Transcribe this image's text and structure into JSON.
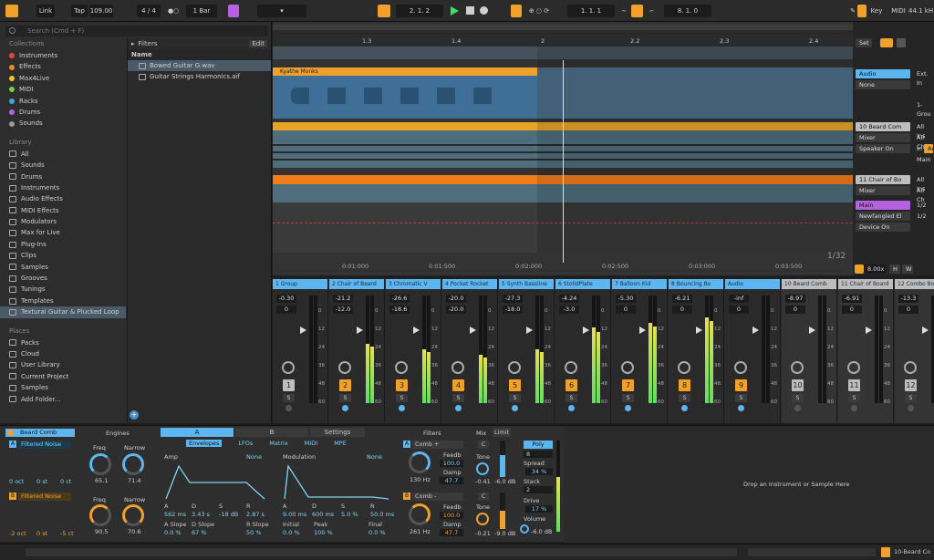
{
  "transport": {
    "link": "Link",
    "tap": "Tap",
    "tempo": "109.00",
    "time_sig": "4 / 4",
    "quant": "1 Bar",
    "arr_pos": "2.   1.   2",
    "loop_start": "1.   1.   1",
    "loop_len": "8.   1.   0",
    "key": "Key",
    "midi": "MIDI",
    "sample_rate": "44.1 kH"
  },
  "browser": {
    "search_placeholder": "Search (Cmd + F)",
    "collections_header": "Collections",
    "collections": [
      {
        "label": "Instruments",
        "color": "#e8433a"
      },
      {
        "label": "Effects",
        "color": "#f08a28"
      },
      {
        "label": "Max4Live",
        "color": "#f2c230"
      },
      {
        "label": "MIDI",
        "color": "#6fd14a"
      },
      {
        "label": "Racks",
        "color": "#3aa5e8"
      },
      {
        "label": "Drums",
        "color": "#b460e0"
      },
      {
        "label": "Sounds",
        "color": "#9a9a9a"
      }
    ],
    "library_header": "Library",
    "library": [
      "All",
      "Sounds",
      "Drums",
      "Instruments",
      "Audio Effects",
      "MIDI Effects",
      "Modulators",
      "Max for Live",
      "Plug-Ins",
      "Clips",
      "Samples",
      "Grooves",
      "Tunings",
      "Templates",
      "Textural Guitar & Plucked Loop"
    ],
    "places_header": "Places",
    "places": [
      "Packs",
      "Cloud",
      "User Library",
      "Current Project",
      "Samples",
      "Add Folder..."
    ],
    "filters_label": "Filters",
    "edit_label": "Edit",
    "name_col": "Name",
    "files": [
      "Bowed Guitar G.wav",
      "Guitar Strings Harmonics.aif"
    ]
  },
  "arrangement": {
    "ruler": [
      "1.3",
      "1.4",
      "2",
      "2.2",
      "2.3",
      "2.4"
    ],
    "clip1_name": "Kyathe Monks",
    "time_ruler": [
      "0:01:000",
      "0:01:500",
      "0:02:000",
      "0:02:500",
      "0:03:000",
      "0:03:500"
    ],
    "grid": "1/32",
    "set_label": "Set",
    "zoom": "8.00x",
    "h_label": "H",
    "w_label": "W"
  },
  "io_panel": {
    "audio": "Audio",
    "ext": "Ext. In",
    "none": "None",
    "group1": "1-Grou",
    "beard_comb": "10 Beard Com",
    "all_ins1": "All Ins",
    "mixer1": "Mixer",
    "all_ch1": "All Ch",
    "speaker_on": "Speaker On",
    "in": "In",
    "auto": "Au",
    "main1": "Main",
    "chair": "11 Chair of Bo",
    "all_ins2": "All Ins",
    "mixer2": "Mixer",
    "all_ch2": "All Ch",
    "main2": "Main",
    "half1": "1/2",
    "newfangled": "Newfangled El",
    "half2": "1/2",
    "device_on": "Device On"
  },
  "mixer": {
    "strips": [
      {
        "name": "1 Group",
        "color": "#5db6f0",
        "vol": "-0.30",
        "pan": "0",
        "num": "1",
        "numcolor": "#bdbdbd",
        "level": 0
      },
      {
        "name": "2 Chair of Beard",
        "color": "#5db6f0",
        "vol": "-21.2",
        "pan": "-12.0",
        "num": "2",
        "numcolor": "#f0a12b",
        "level": 0.55
      },
      {
        "name": "3 Chromatic V",
        "color": "#5db6f0",
        "vol": "-26.6",
        "pan": "-18.6",
        "num": "3",
        "numcolor": "#f0a12b",
        "level": 0.5
      },
      {
        "name": "4 Pocket Rocket",
        "color": "#5db6f0",
        "vol": "-20.0",
        "pan": "-20.0",
        "num": "4",
        "numcolor": "#f0a12b",
        "level": 0.45
      },
      {
        "name": "5 Synth Bassline",
        "color": "#5db6f0",
        "vol": "-27.3",
        "pan": "-18.0",
        "num": "5",
        "numcolor": "#f0a12b",
        "level": 0.5
      },
      {
        "name": "6 StolidPlate",
        "color": "#5db6f0",
        "vol": "-4.24",
        "pan": "-3.0",
        "num": "6",
        "numcolor": "#f0a12b",
        "level": 0.7
      },
      {
        "name": "7 Balloon Kid",
        "color": "#5db6f0",
        "vol": "-5.30",
        "pan": "0",
        "num": "7",
        "numcolor": "#f0a12b",
        "level": 0.75
      },
      {
        "name": "8 Bouncing Bo",
        "color": "#5db6f0",
        "vol": "-6.21",
        "pan": "0",
        "num": "8",
        "numcolor": "#f0a12b",
        "level": 0.8
      },
      {
        "name": "Audio",
        "color": "#5db6f0",
        "vol": "-inf",
        "pan": "0",
        "num": "9",
        "numcolor": "#f0a12b",
        "level": 0
      },
      {
        "name": "10 Beard Comb",
        "color": "#bdbdbd",
        "vol": "-8.97",
        "pan": "0",
        "num": "10",
        "numcolor": "#bdbdbd",
        "level": 0
      },
      {
        "name": "11 Chair of Board",
        "color": "#bdbdbd",
        "vol": "-6.91",
        "pan": "0",
        "num": "11",
        "numcolor": "#bdbdbd",
        "level": 0
      },
      {
        "name": "12 Combo Bo",
        "color": "#bdbdbd",
        "vol": "-13.3",
        "pan": "0",
        "num": "12",
        "numcolor": "#bdbdbd",
        "level": 0
      }
    ],
    "db_scale": [
      "6",
      "0",
      "6",
      "12",
      "18",
      "24",
      "30",
      "36",
      "42",
      "48",
      "54",
      "60"
    ]
  },
  "device": {
    "title": "Beard Comb",
    "engines": "Engines",
    "osc_a": "Filtered Noise",
    "osc_b": "Filtered Noise",
    "a_vals": [
      "0 oct",
      "0 st",
      "0 ct"
    ],
    "b_vals": [
      "-2 oct",
      "0 st",
      "-5 ct"
    ],
    "freq_label": "Freq",
    "narrow_label": "Narrow",
    "freq_a": "65.1",
    "narrow_a": "71.4",
    "freq_b": "90.5",
    "narrow_b": "70.6",
    "tab_a": "A",
    "tab_b": "B",
    "tab_settings": "Settings",
    "env_tabs": [
      "Envelopes",
      "LFOs",
      "Matrix",
      "MIDI",
      "MPE"
    ],
    "amp": "Amp",
    "modulation": "Modulation",
    "none": "None",
    "amp_adsr_labels": [
      "A",
      "D",
      "S",
      "R"
    ],
    "amp_adsr": [
      "562 ms",
      "3.43 s",
      "-18 dB",
      "2.87 s"
    ],
    "amp_slopes_labels": [
      "A Slope",
      "D Slope",
      "R Slope"
    ],
    "amp_slopes": [
      "0.0 %",
      "67 %",
      "50 %"
    ],
    "mod_adsr": [
      "9.00 ms",
      "600 ms",
      "5.0 %",
      "50.0 ms"
    ],
    "mod_extra_labels": [
      "Initial",
      "Peak",
      "Final"
    ],
    "mod_extra": [
      "0.0 %",
      "100 %",
      "0.0 %"
    ],
    "filters": "Filters",
    "comb": "Comb +",
    "comb2": "Comb -",
    "feedb": "Feedb",
    "damp": "Damp",
    "f1_hz": "130 Hz",
    "f1_feedb": "100.0",
    "f1_damp": "47.7",
    "f2_hz": "261 Hz",
    "f2_feedb": "100.0",
    "f2_damp": "47.7",
    "mix": "Mix",
    "limit": "Limit",
    "c": "C",
    "tone": "Tone",
    "tone1": "-0.41",
    "db1": "-6.0 dB",
    "tone2": "-0.21",
    "db2": "-9.0 dB",
    "poly": "Poly",
    "voices": "8",
    "spread": "Spread",
    "spread_val": "34 %",
    "stack": "Stack",
    "stack_val": "2",
    "drive": "Drive",
    "drive_val": "17 %",
    "volume": "Volume",
    "volume_val": "-6.0 dB",
    "drop_hint": "Drop an Instrument or Sample Here"
  },
  "status": {
    "track": "10-Beard Co"
  }
}
